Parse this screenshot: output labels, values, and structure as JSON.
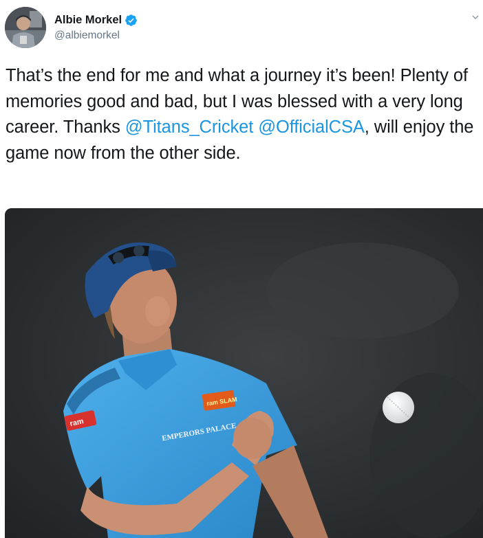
{
  "author": {
    "display_name": "Albie Morkel",
    "handle": "@albiemorkel",
    "verified": true
  },
  "tweet": {
    "text_parts": [
      "That’s the end for me and what a journey it’s been! Plenty of memories good and bad, but I was blessed with a very long career. Thanks ",
      "@Titans_Cricket",
      " ",
      "@OfficialCSA",
      ", will enjoy the game now from the other side."
    ]
  },
  "media": {
    "jersey_sponsor": "EMPERORS PALACE",
    "cap_brand_text": "ram",
    "team_badge_text": "ram SLAM"
  },
  "icons": {
    "verified": "verified-badge-icon",
    "caret": "chevron-down-icon"
  },
  "colors": {
    "link": "#1b95e0",
    "verified": "#1da1f2",
    "handle": "#657786",
    "jersey": "#3a9fe0"
  }
}
